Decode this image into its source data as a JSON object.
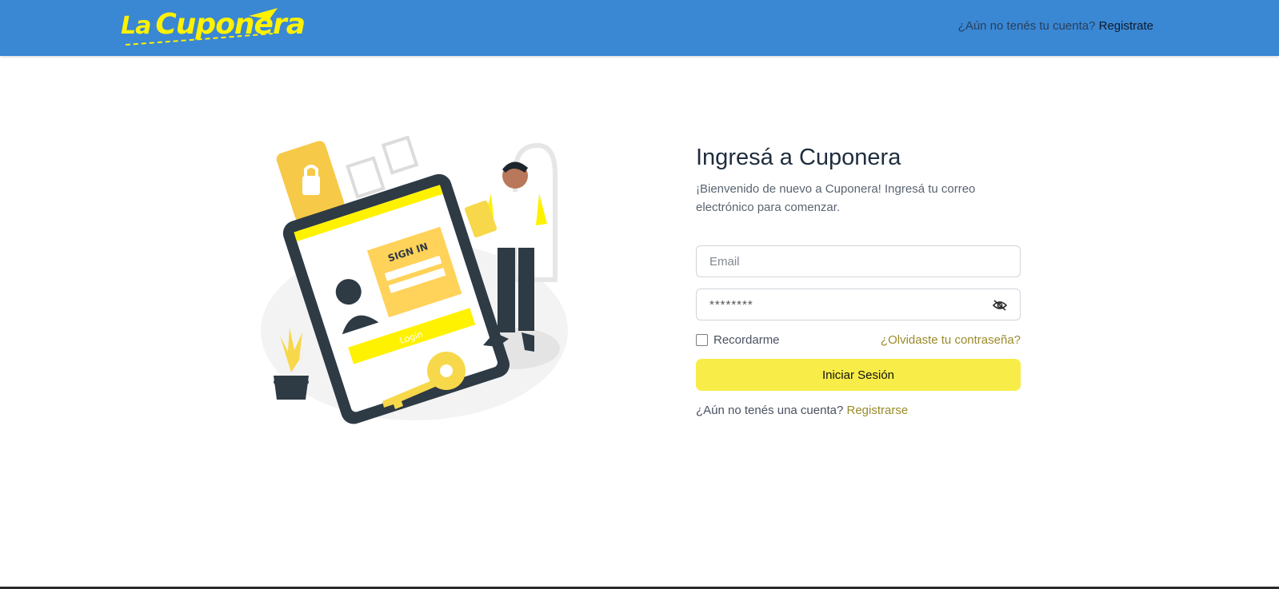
{
  "header": {
    "logo_text_la": "La",
    "logo_text_main": "Cuponera",
    "nav_prompt": "¿Aún no tenés tu cuenta?",
    "nav_link": "Registrate"
  },
  "illustration": {
    "sign_in_label": "SIGN IN",
    "login_label": "Login"
  },
  "form": {
    "title": "Ingresá a Cuponera",
    "subtitle": "¡Bienvenido de nuevo a Cuponera! Ingresá tu correo electrónico para comenzar.",
    "email_placeholder": "Email",
    "password_value": "********",
    "remember_label": "Recordarme",
    "forgot_link": "¿Olvidaste tu contraseña?",
    "submit_label": "Iniciar Sesión",
    "signup_prompt": "¿Aún no tenés una cuenta?",
    "signup_link": "Registrarse"
  },
  "colors": {
    "header_bg": "#3a87d4",
    "accent_yellow": "#f8ed48",
    "logo_yellow": "#fff200",
    "link_olive": "#9b8a2a"
  },
  "icons": {
    "password_toggle": "eye-slash-icon",
    "remember_checkbox": "checkbox-icon"
  }
}
